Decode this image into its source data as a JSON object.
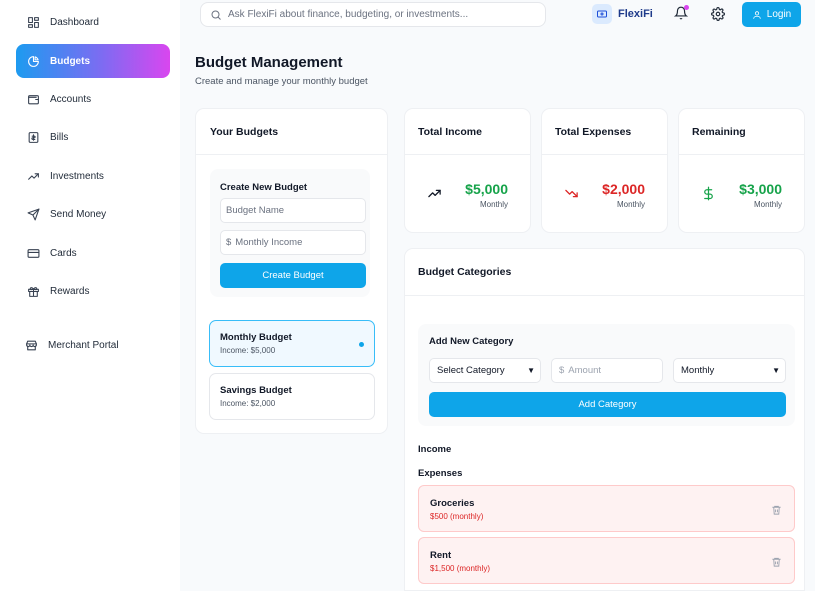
{
  "sidebar": {
    "items": [
      {
        "label": "Dashboard",
        "icon": "dashboard-icon"
      },
      {
        "label": "Budgets",
        "icon": "pie-chart-icon"
      },
      {
        "label": "Accounts",
        "icon": "wallet-icon"
      },
      {
        "label": "Bills",
        "icon": "receipt-icon"
      },
      {
        "label": "Investments",
        "icon": "trending-up-icon"
      },
      {
        "label": "Send Money",
        "icon": "send-icon"
      },
      {
        "label": "Cards",
        "icon": "credit-card-icon"
      },
      {
        "label": "Rewards",
        "icon": "gift-icon"
      }
    ],
    "merchant_portal": "Merchant Portal",
    "active_gradient": [
      "#1d9bf0",
      "#d946ef"
    ]
  },
  "header": {
    "search_placeholder": "Ask FlexiFi about finance, budgeting, or investments...",
    "brand": "FlexiFi",
    "login_label": "Login"
  },
  "page": {
    "title": "Budget Management",
    "subtitle": "Create and manage your monthly budget"
  },
  "your_budgets": {
    "title": "Your Budgets",
    "create_title": "Create New Budget",
    "name_placeholder": "Budget Name",
    "income_placeholder": "Monthly Income",
    "create_button": "Create Budget",
    "items": [
      {
        "name": "Monthly Budget",
        "income": "Income: $5,000",
        "selected": true
      },
      {
        "name": "Savings Budget",
        "income": "Income: $2,000",
        "selected": false
      }
    ]
  },
  "stats": [
    {
      "title": "Total Income",
      "amount": "$5,000",
      "period": "Monthly",
      "color": "#16a34a",
      "icon": "trending-up-icon"
    },
    {
      "title": "Total Expenses",
      "amount": "$2,000",
      "period": "Monthly",
      "color": "#dc2626",
      "icon": "trending-down-icon"
    },
    {
      "title": "Remaining",
      "amount": "$3,000",
      "period": "Monthly",
      "color": "#16a34a",
      "icon": "dollar-icon"
    }
  ],
  "categories": {
    "title": "Budget Categories",
    "add_title": "Add New Category",
    "category_select": "Select Category",
    "amount_placeholder": "Amount",
    "frequency_select": "Monthly",
    "add_button": "Add Category",
    "income_label": "Income",
    "expenses_label": "Expenses",
    "expenses": [
      {
        "name": "Groceries",
        "detail": "$500 (monthly)"
      },
      {
        "name": "Rent",
        "detail": "$1,500 (monthly)"
      }
    ]
  }
}
